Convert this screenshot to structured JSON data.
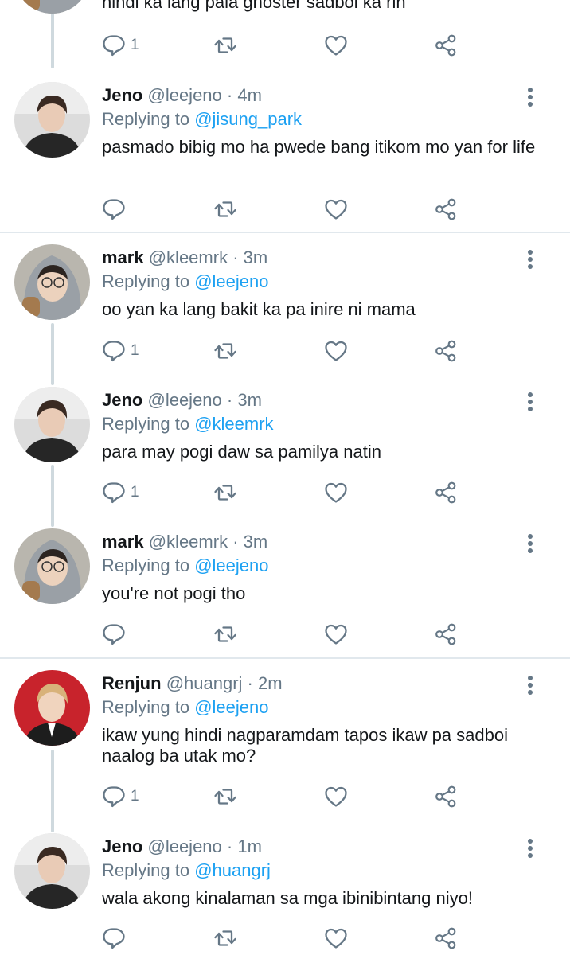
{
  "tweets": [
    {
      "text": "hindi ka lang pala ghoster sadboi ka rin",
      "reply_count": "1"
    },
    {
      "name": "Jeno",
      "handle": "@leejeno",
      "time": "4m",
      "replying_prefix": "Replying to",
      "mention": "@jisung_park",
      "text": "pasmado bibig mo ha pwede bang itikom mo yan for life",
      "reply_count": ""
    },
    {
      "name": "mark",
      "handle": "@kleemrk",
      "time": "3m",
      "replying_prefix": "Replying to",
      "mention": "@leejeno",
      "text": "oo yan ka lang bakit ka pa inire ni mama",
      "reply_count": "1"
    },
    {
      "name": "Jeno",
      "handle": "@leejeno",
      "time": "3m",
      "replying_prefix": "Replying to",
      "mention": "@kleemrk",
      "text": "para may pogi daw sa pamilya natin",
      "reply_count": "1"
    },
    {
      "name": "mark",
      "handle": "@kleemrk",
      "time": "3m",
      "replying_prefix": "Replying to",
      "mention": "@leejeno",
      "text": "you're not pogi tho",
      "reply_count": ""
    },
    {
      "name": "Renjun",
      "handle": "@huangrj",
      "time": "2m",
      "replying_prefix": "Replying to",
      "mention": "@leejeno",
      "text": "ikaw yung hindi nagparamdam tapos ikaw pa sadboi naalog ba utak mo?",
      "reply_count": "1"
    },
    {
      "name": "Jeno",
      "handle": "@leejeno",
      "time": "1m",
      "replying_prefix": "Replying to",
      "mention": "@huangrj",
      "text": "wala akong kinalaman sa mga ibinibintang niyo!",
      "reply_count": ""
    }
  ],
  "separator": "·",
  "icons": {
    "reply": "reply-icon",
    "retweet": "retweet-icon",
    "like": "heart-icon",
    "share": "share-icon",
    "more": "more-vertical-icon"
  },
  "colors": {
    "mention": "#1da1f2",
    "secondary_text": "#657786",
    "divider": "#e1e8ed"
  }
}
